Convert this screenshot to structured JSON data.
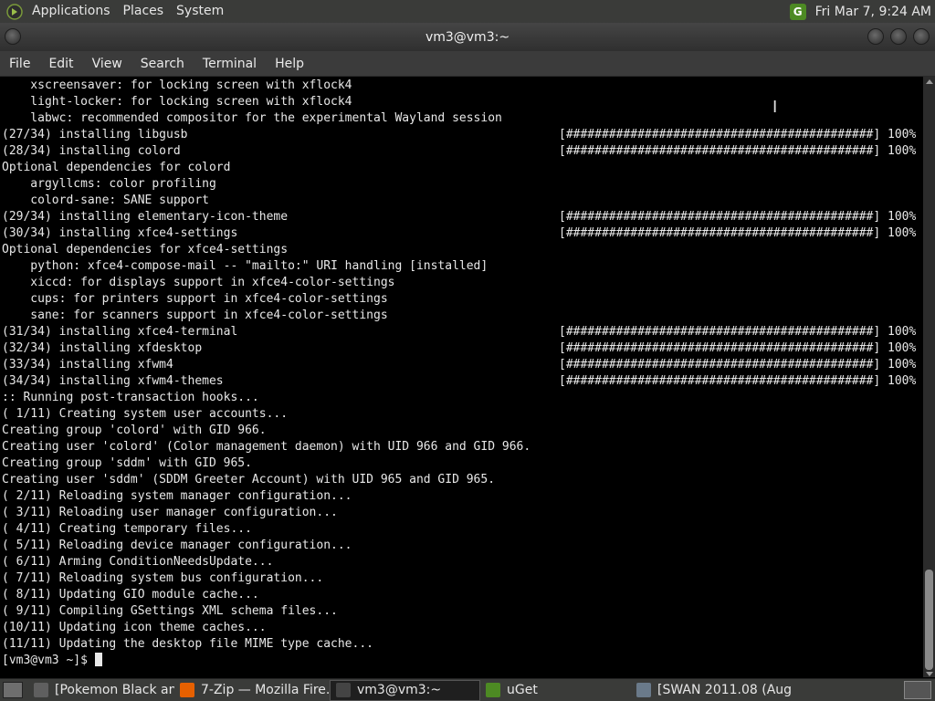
{
  "top_panel": {
    "menus": [
      "Applications",
      "Places",
      "System"
    ],
    "clock": "Fri Mar 7,  9:24 AM",
    "tray_icon": "uget-icon"
  },
  "window": {
    "title": "vm3@vm3:~"
  },
  "menubar": [
    "File",
    "Edit",
    "View",
    "Search",
    "Terminal",
    "Help"
  ],
  "terminal": {
    "lines": [
      {
        "text": "    xscreensaver: for locking screen with xflock4"
      },
      {
        "text": "    light-locker: for locking screen with xflock4"
      },
      {
        "text": "    labwc: recommended compositor for the experimental Wayland session"
      },
      {
        "text": "(27/34) installing libgusb",
        "bar": "[###########################################] 100%"
      },
      {
        "text": "(28/34) installing colord",
        "bar": "[###########################################] 100%"
      },
      {
        "text": "Optional dependencies for colord"
      },
      {
        "text": "    argyllcms: color profiling"
      },
      {
        "text": "    colord-sane: SANE support"
      },
      {
        "text": "(29/34) installing elementary-icon-theme",
        "bar": "[###########################################] 100%"
      },
      {
        "text": "(30/34) installing xfce4-settings",
        "bar": "[###########################################] 100%"
      },
      {
        "text": "Optional dependencies for xfce4-settings"
      },
      {
        "text": "    python: xfce4-compose-mail -- \"mailto:\" URI handling [installed]"
      },
      {
        "text": "    xiccd: for displays support in xfce4-color-settings"
      },
      {
        "text": "    cups: for printers support in xfce4-color-settings"
      },
      {
        "text": "    sane: for scanners support in xfce4-color-settings"
      },
      {
        "text": "(31/34) installing xfce4-terminal",
        "bar": "[###########################################] 100%"
      },
      {
        "text": "(32/34) installing xfdesktop",
        "bar": "[###########################################] 100%"
      },
      {
        "text": "(33/34) installing xfwm4",
        "bar": "[###########################################] 100%"
      },
      {
        "text": "(34/34) installing xfwm4-themes",
        "bar": "[###########################################] 100%"
      },
      {
        "text": ":: Running post-transaction hooks..."
      },
      {
        "text": "( 1/11) Creating system user accounts..."
      },
      {
        "text": "Creating group 'colord' with GID 966."
      },
      {
        "text": "Creating user 'colord' (Color management daemon) with UID 966 and GID 966."
      },
      {
        "text": "Creating group 'sddm' with GID 965."
      },
      {
        "text": "Creating user 'sddm' (SDDM Greeter Account) with UID 965 and GID 965."
      },
      {
        "text": "( 2/11) Reloading system manager configuration..."
      },
      {
        "text": "( 3/11) Reloading user manager configuration..."
      },
      {
        "text": "( 4/11) Creating temporary files..."
      },
      {
        "text": "( 5/11) Reloading device manager configuration..."
      },
      {
        "text": "( 6/11) Arming ConditionNeedsUpdate..."
      },
      {
        "text": "( 7/11) Reloading system bus configuration..."
      },
      {
        "text": "( 8/11) Updating GIO module cache..."
      },
      {
        "text": "( 9/11) Compiling GSettings XML schema files..."
      },
      {
        "text": "(10/11) Updating icon theme caches..."
      },
      {
        "text": "(11/11) Updating the desktop file MIME type cache..."
      }
    ],
    "prompt": "[vm3@vm3 ~]$ "
  },
  "taskbar": {
    "tasks": [
      {
        "label": "[Pokemon Black an...",
        "icon": "folder-icon",
        "color": "#5f5f5f",
        "active": false
      },
      {
        "label": "7-Zip — Mozilla Fire...",
        "icon": "firefox-icon",
        "color": "#e66000",
        "active": false
      },
      {
        "label": "vm3@vm3:~",
        "icon": "terminal-icon",
        "color": "#444444",
        "active": true
      },
      {
        "label": "uGet",
        "icon": "uget-icon",
        "color": "#4d8a23",
        "active": false
      },
      {
        "label": "[SWAN 2011.08 (Aug...",
        "icon": "app-icon",
        "color": "#6a7a8a",
        "active": false
      }
    ]
  }
}
